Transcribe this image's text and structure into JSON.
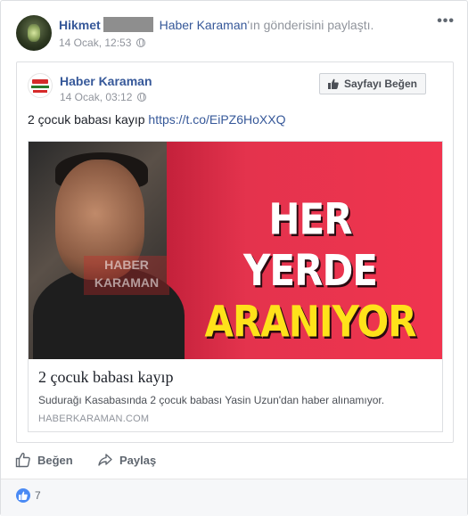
{
  "post": {
    "author": "Hikmet",
    "shared_text_link": "Haber Karaman",
    "shared_text_suffix": "'ın gönderisini paylaştı.",
    "timestamp": "14 Ocak, 12:53",
    "menu_icon": "more-dots-icon"
  },
  "shared": {
    "page_name": "Haber Karaman",
    "timestamp": "14 Ocak, 03:12",
    "like_page_label": "Sayfayı Beğen",
    "text": "2 çocuk babası kayıp",
    "url": "https://t.co/EiPZ6HoXXQ",
    "card": {
      "image_headline_1": "HER YERDE",
      "image_headline_2": "ARANIYOR",
      "watermark_1": "HABER",
      "watermark_2": "KARAMAN",
      "title": "2 çocuk babası kayıp",
      "description": "Sudurağı Kasabasında 2 çocuk babası Yasin Uzun'dan haber alınamıyor.",
      "domain": "HABERKARAMAN.COM"
    }
  },
  "actions": {
    "like_label": "Beğen",
    "share_label": "Paylaş"
  },
  "reactions": {
    "count": "7"
  },
  "colors": {
    "link": "#365899",
    "meta": "#90949c",
    "like_blue": "#4a8af4",
    "headline_yellow": "#ffe21a",
    "headline_red": "#e4334d"
  }
}
